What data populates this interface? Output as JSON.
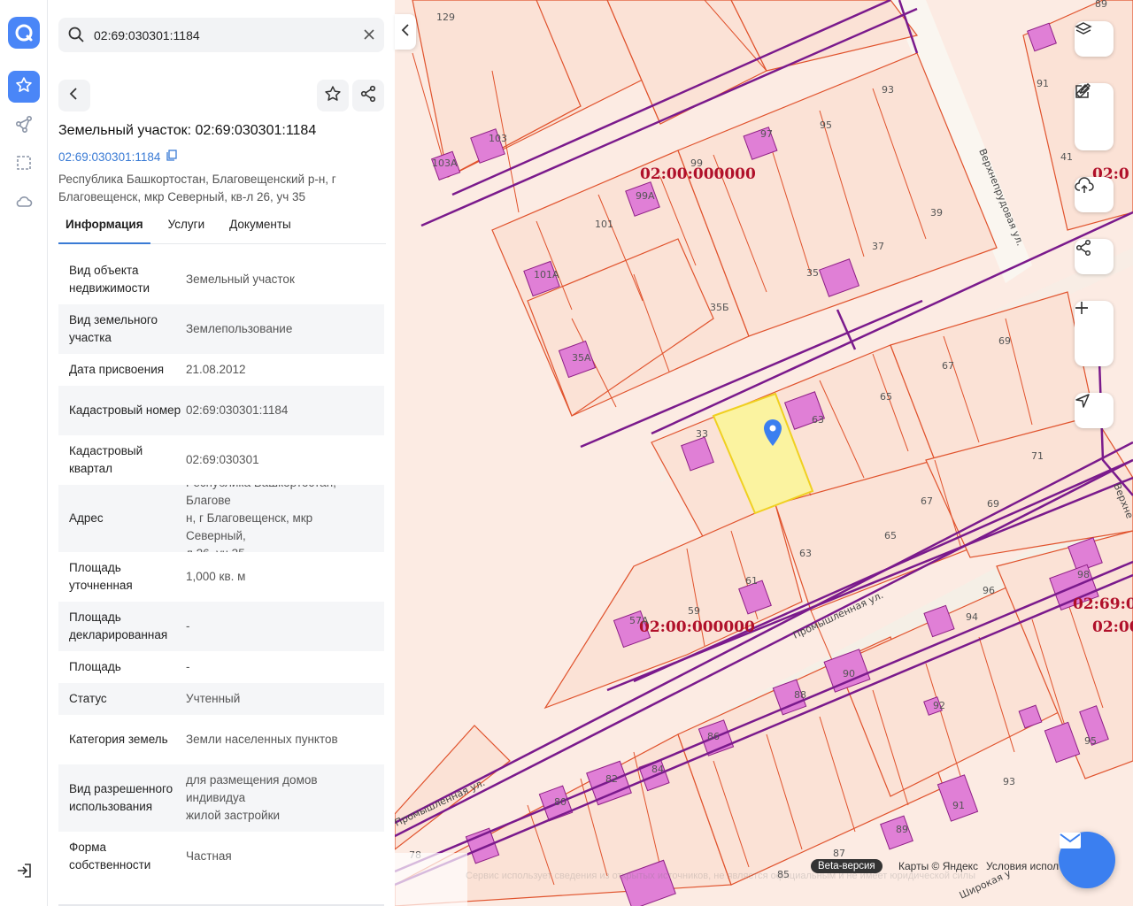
{
  "search": {
    "value": "02:69:030301:1184"
  },
  "object": {
    "title": "Земельный участок: 02:69:030301:1184",
    "cadastral_link": "02:69:030301:1184",
    "address_short": "Республика Башкортостан, Благовещенский р-н, г Благовещенск, мкр Северный, кв-л 26, уч 35"
  },
  "tabs": [
    {
      "label": "Информация",
      "active": true
    },
    {
      "label": "Услуги",
      "active": false
    },
    {
      "label": "Документы",
      "active": false
    }
  ],
  "info": [
    {
      "key": "Вид объекта недвижимости",
      "value": "Земельный участок"
    },
    {
      "key": "Вид земельного участка",
      "value": "Землепользование"
    },
    {
      "key": "Дата присвоения",
      "value": "21.08.2012"
    },
    {
      "key": "Кадастровый номер",
      "value": "02:69:030301:1184"
    },
    {
      "key": "Кадастровый квартал",
      "value": "02:69:030301"
    },
    {
      "key": "Адрес",
      "value": "Республика Башкортостан, Благове\nн, г Благовещенск, мкр Северный,\nл 26, уч 35"
    },
    {
      "key": "Площадь уточненная",
      "value": "1,000 кв. м"
    },
    {
      "key": "Площадь декларированная",
      "value": "-"
    },
    {
      "key": "Площадь",
      "value": "-"
    },
    {
      "key": "Статус",
      "value": "Учтенный"
    },
    {
      "key": "Категория земель",
      "value": "Земли населенных пунктов"
    },
    {
      "key": "Вид разрешенного использования",
      "value": "для размещения домов индивидуа\nжилой застройки"
    },
    {
      "key": "Форма собственности",
      "value": "Частная"
    }
  ],
  "map": {
    "zone_labels": [
      "02:00:000000",
      "02:00:000000",
      "02:69:0",
      "02:00",
      "02:0"
    ],
    "streets": [
      "Верхнепрудовая ул.",
      "Промышленная ул.",
      "Промышленная ул.",
      "Широкая у",
      "Верхне"
    ],
    "lot_numbers": [
      "129",
      "93",
      "95",
      "97",
      "103",
      "103А",
      "99",
      "99А",
      "39",
      "37",
      "35",
      "101",
      "101А",
      "35Б",
      "35А",
      "69",
      "67",
      "65",
      "63",
      "33",
      "71",
      "67",
      "69",
      "65",
      "63",
      "61",
      "59",
      "57А",
      "96",
      "94",
      "90",
      "88",
      "86",
      "84",
      "82",
      "80",
      "78",
      "85",
      "87",
      "89",
      "91",
      "92",
      "93",
      "95",
      "98",
      "89",
      "91",
      "41"
    ],
    "beta_label": "Beta-версия",
    "yandex_credit": "Карты © Яндекс",
    "terms": "Условия испол",
    "disclaimer": "Сервис использует сведения из открытых источников, не является официальным и не имеет юридической силы"
  },
  "colors": {
    "accent": "#4a86f7",
    "selected_parcel": "#fbf3a0",
    "parcel_border": "#e0522c",
    "building": "#e07fd6",
    "zone_line": "#7a1a8c"
  },
  "icons": [
    "logo-icon",
    "star-icon",
    "route-icon",
    "select-area-icon",
    "cloud-icon",
    "exit-icon",
    "search-icon",
    "clear-icon",
    "back-icon",
    "share-icon",
    "copy-icon",
    "layers-icon",
    "ruler-icon",
    "edit-icon",
    "upload-icon",
    "plus-icon",
    "minus-icon",
    "locate-icon",
    "mail-icon",
    "pin-icon"
  ]
}
